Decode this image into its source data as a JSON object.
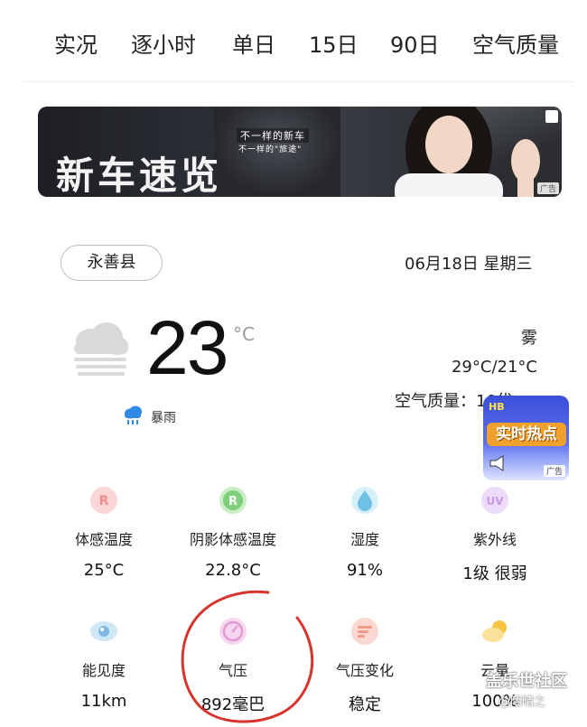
{
  "tabs": [
    "实况",
    "逐小时",
    "单日",
    "15日",
    "90日",
    "空气质量"
  ],
  "banner_ad": {
    "tag_line1": "不一样的新车",
    "tag_line2": "不一样的\"旅途\"",
    "headline": "新车速览",
    "ad_label": "广告"
  },
  "location": "永善县",
  "date": "06月18日 星期三",
  "current": {
    "temperature": "23",
    "unit": "°C",
    "condition": "雾",
    "temp_range": "29°C/21°C",
    "air_quality": "空气质量：10优",
    "alert": "暴雨"
  },
  "float_ad": {
    "badge": "HB",
    "title": "实时热点",
    "ad_label": "广告"
  },
  "details": [
    {
      "label": "体感温度",
      "value": "25°C",
      "icon": "feels-like-icon",
      "color": "#f4a3a3"
    },
    {
      "label": "阴影体感温度",
      "value": "22.8°C",
      "icon": "shade-feels-like-icon",
      "color": "#7ed07a"
    },
    {
      "label": "湿度",
      "value": "91%",
      "icon": "humidity-icon",
      "color": "#7ec8e8"
    },
    {
      "label": "紫外线",
      "value": "1级 很弱",
      "icon": "uv-icon",
      "color": "#d7b3f0"
    },
    {
      "label": "能见度",
      "value": "11km",
      "icon": "visibility-icon",
      "color": "#8fc8ec"
    },
    {
      "label": "气压",
      "value": "892毫巴",
      "icon": "pressure-icon",
      "color": "#e69bd6"
    },
    {
      "label": "气压变化",
      "value": "稳定",
      "icon": "pressure-change-icon",
      "color": "#f4a08e"
    },
    {
      "label": "云量",
      "value": "100%",
      "icon": "cloud-cover-icon",
      "color": "#f5c542"
    }
  ],
  "watermark": {
    "main": "盖乐世社区",
    "sub": "@陌晴之"
  }
}
